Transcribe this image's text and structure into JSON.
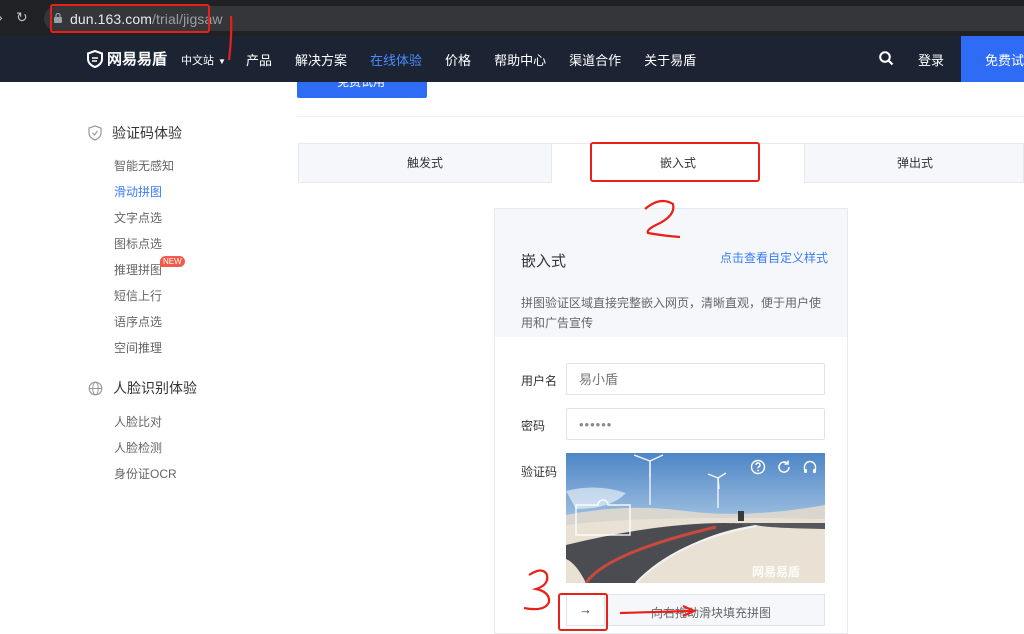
{
  "browser": {
    "url_host": "dun.163.com",
    "url_path": "/trial/jigsaw"
  },
  "header": {
    "logo_text": "网易易盾",
    "lang": "中文站",
    "nav": [
      "产品",
      "解决方案",
      "在线体验",
      "价格",
      "帮助中心",
      "渠道合作",
      "关于易盾"
    ],
    "active_nav": "在线体验",
    "login": "登录",
    "cta": "免费试用"
  },
  "top_cta": "免费试用",
  "sidebar": {
    "group1_title": "验证码体验",
    "group1_items": [
      "智能无感知",
      "滑动拼图",
      "文字点选",
      "图标点选",
      "推理拼图",
      "短信上行",
      "语序点选",
      "空间推理"
    ],
    "active_item": "滑动拼图",
    "new_badge": "NEW",
    "group2_title": "人脸识别体验",
    "group2_items": [
      "人脸比对",
      "人脸检测",
      "身份证OCR"
    ]
  },
  "tabs": [
    "触发式",
    "嵌入式",
    "弹出式"
  ],
  "active_tab": "嵌入式",
  "panel": {
    "title": "嵌入式",
    "custom_link": "点击查看自定义样式",
    "desc": "拼图验证区域直接完整嵌入网页，清晰直观，便于用户使用和广告宣传",
    "username_label": "用户名",
    "username_placeholder": "易小盾",
    "password_label": "密码",
    "password_value": "••••••",
    "captcha_label": "验证码",
    "watermark": "网易易盾",
    "slider_text": "向右拖动滑块填充拼图"
  },
  "annotations": [
    "1",
    "2",
    "3"
  ],
  "colors": {
    "header_bg": "#1c2434",
    "accent": "#2f6cf6",
    "annotation": "#e8201a"
  }
}
